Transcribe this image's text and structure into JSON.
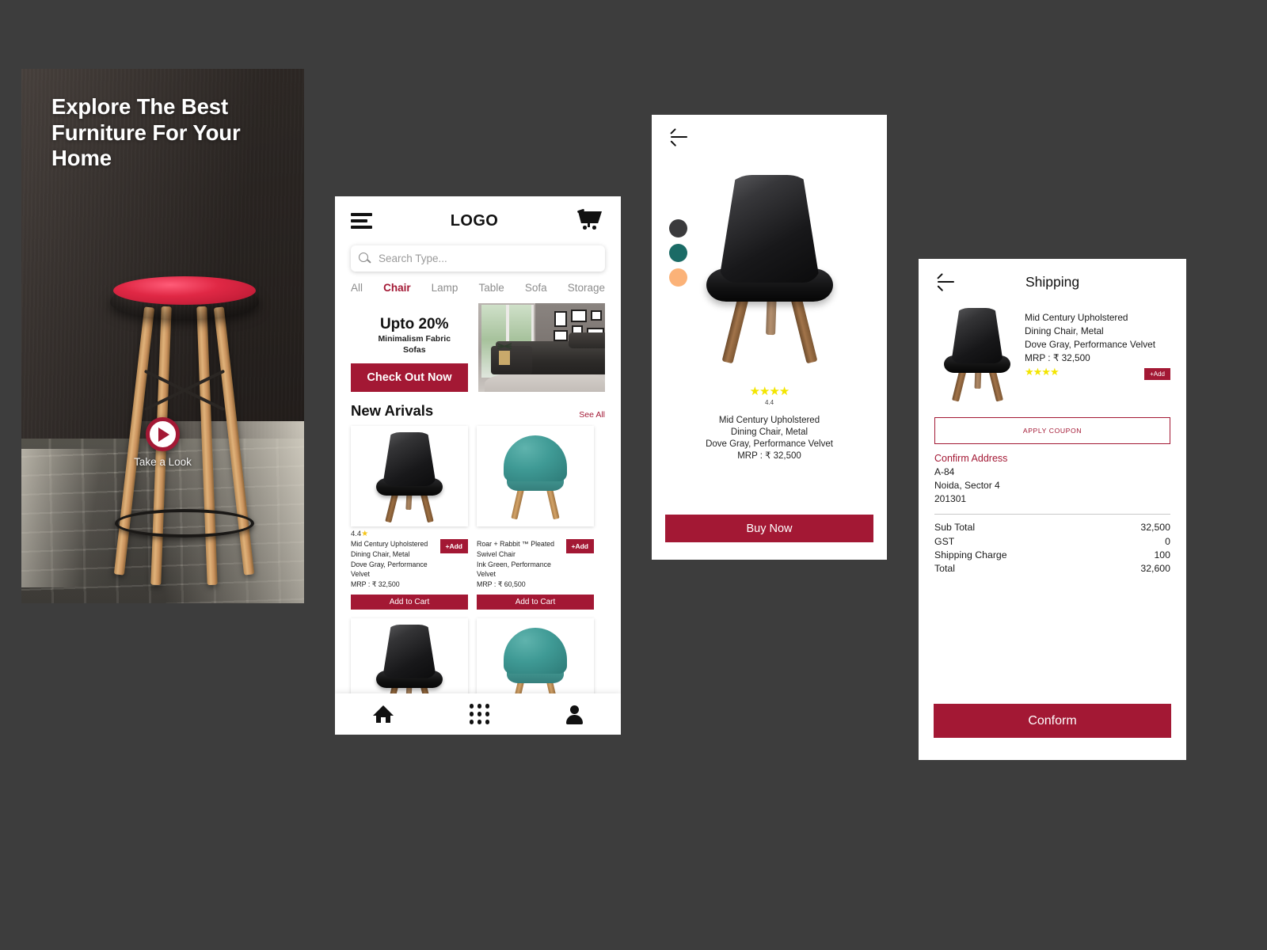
{
  "brand": {
    "accent": "#a31834",
    "star": "#f3e500",
    "rupee": "₹"
  },
  "splash": {
    "title": "Explore The Best Furniture For Your Home",
    "play_label": "Take a Look",
    "play_icon": "play-icon"
  },
  "home": {
    "logo": "LOGO",
    "menu_icon": "hamburger-icon",
    "cart_icon": "shopping-cart-icon",
    "search": {
      "placeholder": "Search Type...",
      "value": "",
      "icon": "search-icon"
    },
    "categories": [
      {
        "label": "All",
        "active": false
      },
      {
        "label": "Chair",
        "active": true
      },
      {
        "label": "Lamp",
        "active": false
      },
      {
        "label": "Table",
        "active": false
      },
      {
        "label": "Sofa",
        "active": false
      },
      {
        "label": "Storage",
        "active": false
      }
    ],
    "promo": {
      "headline": "Upto 20%",
      "sub_line1": "Minimalism Fabric",
      "sub_line2": "Sofas",
      "cta": "Check Out Now"
    },
    "arrivals": {
      "title": "New Arivals",
      "see_all": "See All"
    },
    "products": [
      {
        "rating": "4.4",
        "name_line1": "Mid Century Upholstered",
        "name_line2": "Dining Chair, Metal",
        "name_line3": "Dove Gray, Performance Velvet",
        "mrp": "MRP : ₹ 32,500",
        "add_label": "+Add",
        "cart_label": "Add to Cart",
        "color": "black"
      },
      {
        "rating": "",
        "name_line1": "Roar + Rabbit ™ Pleated",
        "name_line2": "Swivel Chair",
        "name_line3": "Ink Green, Performance Velvet",
        "mrp": "MRP : ₹ 60,500",
        "add_label": "+Add",
        "cart_label": "Add to Cart",
        "color": "teal"
      }
    ],
    "nav": [
      {
        "icon": "home-icon",
        "name": "nav-home"
      },
      {
        "icon": "grid-apps-icon",
        "name": "nav-categories"
      },
      {
        "icon": "user-profile-icon",
        "name": "nav-profile"
      }
    ]
  },
  "detail": {
    "back_icon": "back-arrow-icon",
    "swatches": [
      {
        "name": "charcoal",
        "hex": "#3a3a3c"
      },
      {
        "name": "teal",
        "hex": "#1b6b66"
      },
      {
        "name": "peach",
        "hex": "#fbb278"
      }
    ],
    "stars": "★★★★",
    "rating": "4.4",
    "desc_line1": "Mid Century Upholstered",
    "desc_line2": "Dining Chair, Metal",
    "desc_line3": "Dove Gray, Performance Velvet",
    "desc_line4": "MRP : ₹ 32,500",
    "buy_label": "Buy Now"
  },
  "shipping": {
    "back_icon": "back-arrow-icon",
    "title": "Shipping",
    "product": {
      "line1": "Mid Century Upholstered",
      "line2": "Dining Chair, Metal",
      "line3": "Dove Gray, Performance Velvet",
      "line4": "MRP : ₹ 32,500",
      "stars": "★★★★",
      "add_label": "+Add"
    },
    "coupon_label": "APPLY COUPON",
    "address": {
      "heading": "Confirm Address",
      "line1": "A-84",
      "line2": "Noida, Sector 4",
      "line3": "201301"
    },
    "totals": [
      {
        "label": "Sub Total",
        "value": "32,500"
      },
      {
        "label": "GST",
        "value": "0"
      },
      {
        "label": "Shipping Charge",
        "value": "100"
      },
      {
        "label": "Total",
        "value": "32,600"
      }
    ],
    "confirm_label": "Conform"
  }
}
